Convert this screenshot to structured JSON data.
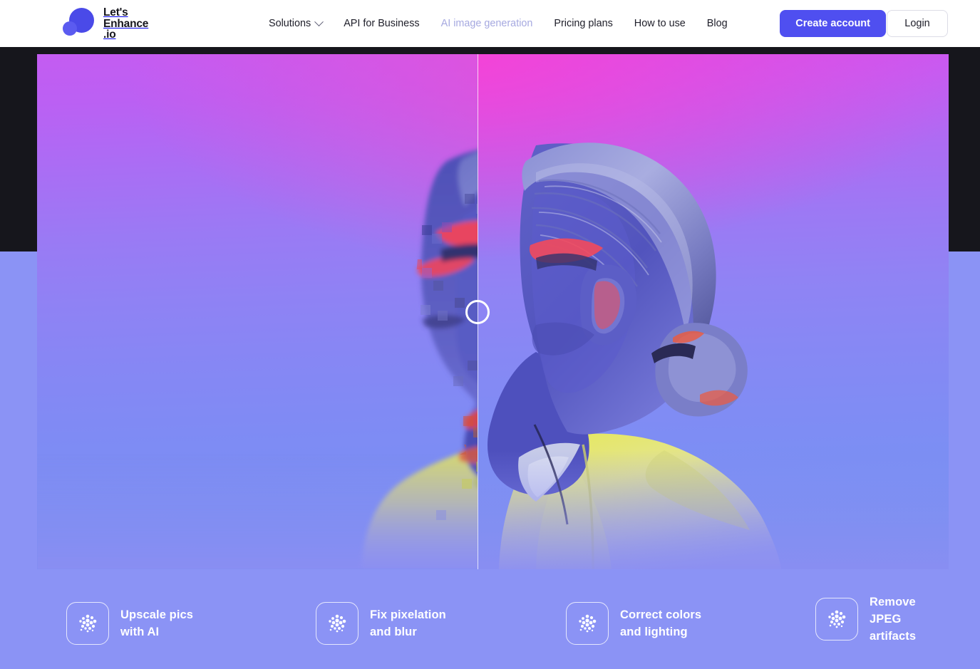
{
  "header": {
    "logo": {
      "name": "lets-enhance-logo",
      "text": "Let's\nEnhance\n.io",
      "flag_alt": "ukraine-flag"
    },
    "nav": [
      {
        "label": "Solutions",
        "has_dropdown": true,
        "muted": false
      },
      {
        "label": "API for Business",
        "has_dropdown": false,
        "muted": false
      },
      {
        "label": "AI image generation",
        "has_dropdown": false,
        "muted": true
      },
      {
        "label": "Pricing plans",
        "has_dropdown": false,
        "muted": false
      },
      {
        "label": "How to use",
        "has_dropdown": false,
        "muted": false
      },
      {
        "label": "Blog",
        "has_dropdown": false,
        "muted": false
      }
    ],
    "create_account_label": "Create account",
    "login_label": "Login",
    "accent_color": "#4f4ff0",
    "background_color": "#ffffff"
  },
  "hero": {
    "type": "before-after-image-comparison",
    "subject": "portrait of a person in profile with a yellow jacket on a pink-to-purple gradient background",
    "before_side": "left (pixelated / low resolution)",
    "after_side": "right (enhanced / sharp)",
    "slider_position_percent": 48,
    "dark_band_color": "#16161c",
    "page_background_color": "#8b93f5",
    "gradient_top_color": "#c45cf2",
    "gradient_bottom_color": "#6d8ff2"
  },
  "features": [
    {
      "label": "Upscale pics\nwith AI",
      "icon": "dot-cluster-icon"
    },
    {
      "label": "Fix pixelation\nand blur",
      "icon": "dot-cluster-icon"
    },
    {
      "label": "Correct colors\nand lighting",
      "icon": "dot-cluster-icon"
    },
    {
      "label": "Remove\nJPEG\nartifacts",
      "icon": "dot-cluster-icon"
    }
  ]
}
